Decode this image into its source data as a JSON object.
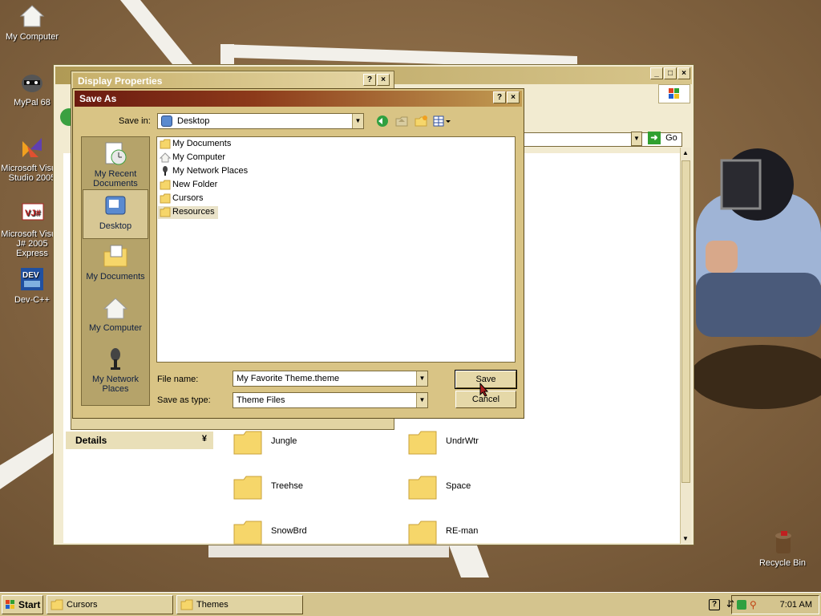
{
  "desktop": {
    "icons": [
      {
        "label": "My Computer",
        "icon": "my-computer-icon"
      },
      {
        "label": "MyPal 68",
        "icon": "raccoon-icon"
      },
      {
        "label": "Microsoft Visual Studio 2005",
        "icon": "visual-studio-icon"
      },
      {
        "label": "Microsoft Visual J# 2005 Express",
        "icon": "vjsharp-icon"
      },
      {
        "label": "Dev-C++",
        "icon": "devcpp-icon"
      },
      {
        "label": "Recycle Bin",
        "icon": "recycle-bin-icon"
      }
    ]
  },
  "themes_window": {
    "go_label": "Go",
    "details_label": "Details",
    "folders": [
      "Jungle",
      "UndrWtr",
      "Treehse",
      "Space",
      "SnowBrd",
      "RE-man"
    ]
  },
  "display_properties": {
    "title": "Display Properties"
  },
  "save_as": {
    "title": "Save As",
    "save_in_label": "Save in:",
    "save_in_value": "Desktop",
    "places": [
      {
        "label": "My Recent Documents",
        "icon": "recent-documents-icon"
      },
      {
        "label": "Desktop",
        "icon": "desktop-icon"
      },
      {
        "label": "My Documents",
        "icon": "my-documents-icon"
      },
      {
        "label": "My Computer",
        "icon": "my-computer-icon"
      },
      {
        "label": "My Network Places",
        "icon": "network-places-icon"
      }
    ],
    "files": [
      {
        "name": "My Documents",
        "icon": "folder-docs-icon"
      },
      {
        "name": "My Computer",
        "icon": "computer-icon"
      },
      {
        "name": "My Network Places",
        "icon": "network-icon"
      },
      {
        "name": "New Folder",
        "icon": "folder-icon"
      },
      {
        "name": "Cursors",
        "icon": "folder-icon"
      },
      {
        "name": "Resources",
        "icon": "folder-icon"
      }
    ],
    "file_name_label": "File name:",
    "file_name_value": "My Favorite Theme.theme",
    "save_as_type_label": "Save as type:",
    "save_as_type_value": "Theme Files",
    "save_button": "Save",
    "cancel_button": "Cancel"
  },
  "taskbar": {
    "start_label": "Start",
    "tasks": [
      "Cursors",
      "Themes"
    ],
    "clock": "7:01 AM"
  },
  "colors": {
    "titlebar_active": "#6b1a10",
    "dialog_face": "#d9c485",
    "taskbar": "#d4c48e"
  }
}
